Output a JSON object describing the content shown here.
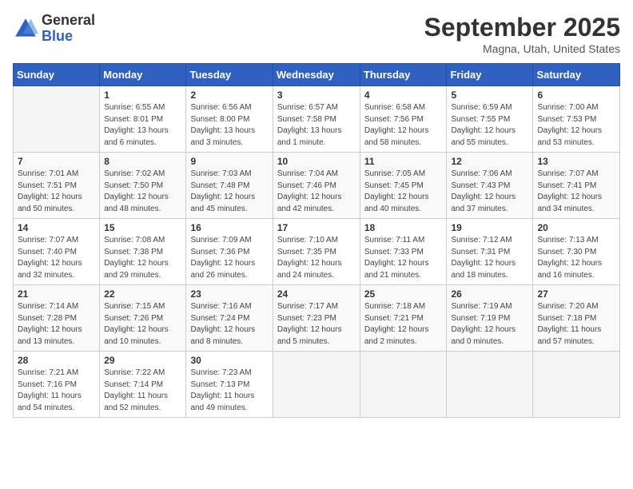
{
  "header": {
    "logo_line1": "General",
    "logo_line2": "Blue",
    "month": "September 2025",
    "location": "Magna, Utah, United States"
  },
  "weekdays": [
    "Sunday",
    "Monday",
    "Tuesday",
    "Wednesday",
    "Thursday",
    "Friday",
    "Saturday"
  ],
  "weeks": [
    [
      {
        "day": "",
        "content": ""
      },
      {
        "day": "1",
        "content": "Sunrise: 6:55 AM\nSunset: 8:01 PM\nDaylight: 13 hours\nand 6 minutes."
      },
      {
        "day": "2",
        "content": "Sunrise: 6:56 AM\nSunset: 8:00 PM\nDaylight: 13 hours\nand 3 minutes."
      },
      {
        "day": "3",
        "content": "Sunrise: 6:57 AM\nSunset: 7:58 PM\nDaylight: 13 hours\nand 1 minute."
      },
      {
        "day": "4",
        "content": "Sunrise: 6:58 AM\nSunset: 7:56 PM\nDaylight: 12 hours\nand 58 minutes."
      },
      {
        "day": "5",
        "content": "Sunrise: 6:59 AM\nSunset: 7:55 PM\nDaylight: 12 hours\nand 55 minutes."
      },
      {
        "day": "6",
        "content": "Sunrise: 7:00 AM\nSunset: 7:53 PM\nDaylight: 12 hours\nand 53 minutes."
      }
    ],
    [
      {
        "day": "7",
        "content": "Sunrise: 7:01 AM\nSunset: 7:51 PM\nDaylight: 12 hours\nand 50 minutes."
      },
      {
        "day": "8",
        "content": "Sunrise: 7:02 AM\nSunset: 7:50 PM\nDaylight: 12 hours\nand 48 minutes."
      },
      {
        "day": "9",
        "content": "Sunrise: 7:03 AM\nSunset: 7:48 PM\nDaylight: 12 hours\nand 45 minutes."
      },
      {
        "day": "10",
        "content": "Sunrise: 7:04 AM\nSunset: 7:46 PM\nDaylight: 12 hours\nand 42 minutes."
      },
      {
        "day": "11",
        "content": "Sunrise: 7:05 AM\nSunset: 7:45 PM\nDaylight: 12 hours\nand 40 minutes."
      },
      {
        "day": "12",
        "content": "Sunrise: 7:06 AM\nSunset: 7:43 PM\nDaylight: 12 hours\nand 37 minutes."
      },
      {
        "day": "13",
        "content": "Sunrise: 7:07 AM\nSunset: 7:41 PM\nDaylight: 12 hours\nand 34 minutes."
      }
    ],
    [
      {
        "day": "14",
        "content": "Sunrise: 7:07 AM\nSunset: 7:40 PM\nDaylight: 12 hours\nand 32 minutes."
      },
      {
        "day": "15",
        "content": "Sunrise: 7:08 AM\nSunset: 7:38 PM\nDaylight: 12 hours\nand 29 minutes."
      },
      {
        "day": "16",
        "content": "Sunrise: 7:09 AM\nSunset: 7:36 PM\nDaylight: 12 hours\nand 26 minutes."
      },
      {
        "day": "17",
        "content": "Sunrise: 7:10 AM\nSunset: 7:35 PM\nDaylight: 12 hours\nand 24 minutes."
      },
      {
        "day": "18",
        "content": "Sunrise: 7:11 AM\nSunset: 7:33 PM\nDaylight: 12 hours\nand 21 minutes."
      },
      {
        "day": "19",
        "content": "Sunrise: 7:12 AM\nSunset: 7:31 PM\nDaylight: 12 hours\nand 18 minutes."
      },
      {
        "day": "20",
        "content": "Sunrise: 7:13 AM\nSunset: 7:30 PM\nDaylight: 12 hours\nand 16 minutes."
      }
    ],
    [
      {
        "day": "21",
        "content": "Sunrise: 7:14 AM\nSunset: 7:28 PM\nDaylight: 12 hours\nand 13 minutes."
      },
      {
        "day": "22",
        "content": "Sunrise: 7:15 AM\nSunset: 7:26 PM\nDaylight: 12 hours\nand 10 minutes."
      },
      {
        "day": "23",
        "content": "Sunrise: 7:16 AM\nSunset: 7:24 PM\nDaylight: 12 hours\nand 8 minutes."
      },
      {
        "day": "24",
        "content": "Sunrise: 7:17 AM\nSunset: 7:23 PM\nDaylight: 12 hours\nand 5 minutes."
      },
      {
        "day": "25",
        "content": "Sunrise: 7:18 AM\nSunset: 7:21 PM\nDaylight: 12 hours\nand 2 minutes."
      },
      {
        "day": "26",
        "content": "Sunrise: 7:19 AM\nSunset: 7:19 PM\nDaylight: 12 hours\nand 0 minutes."
      },
      {
        "day": "27",
        "content": "Sunrise: 7:20 AM\nSunset: 7:18 PM\nDaylight: 11 hours\nand 57 minutes."
      }
    ],
    [
      {
        "day": "28",
        "content": "Sunrise: 7:21 AM\nSunset: 7:16 PM\nDaylight: 11 hours\nand 54 minutes."
      },
      {
        "day": "29",
        "content": "Sunrise: 7:22 AM\nSunset: 7:14 PM\nDaylight: 11 hours\nand 52 minutes."
      },
      {
        "day": "30",
        "content": "Sunrise: 7:23 AM\nSunset: 7:13 PM\nDaylight: 11 hours\nand 49 minutes."
      },
      {
        "day": "",
        "content": ""
      },
      {
        "day": "",
        "content": ""
      },
      {
        "day": "",
        "content": ""
      },
      {
        "day": "",
        "content": ""
      }
    ]
  ]
}
